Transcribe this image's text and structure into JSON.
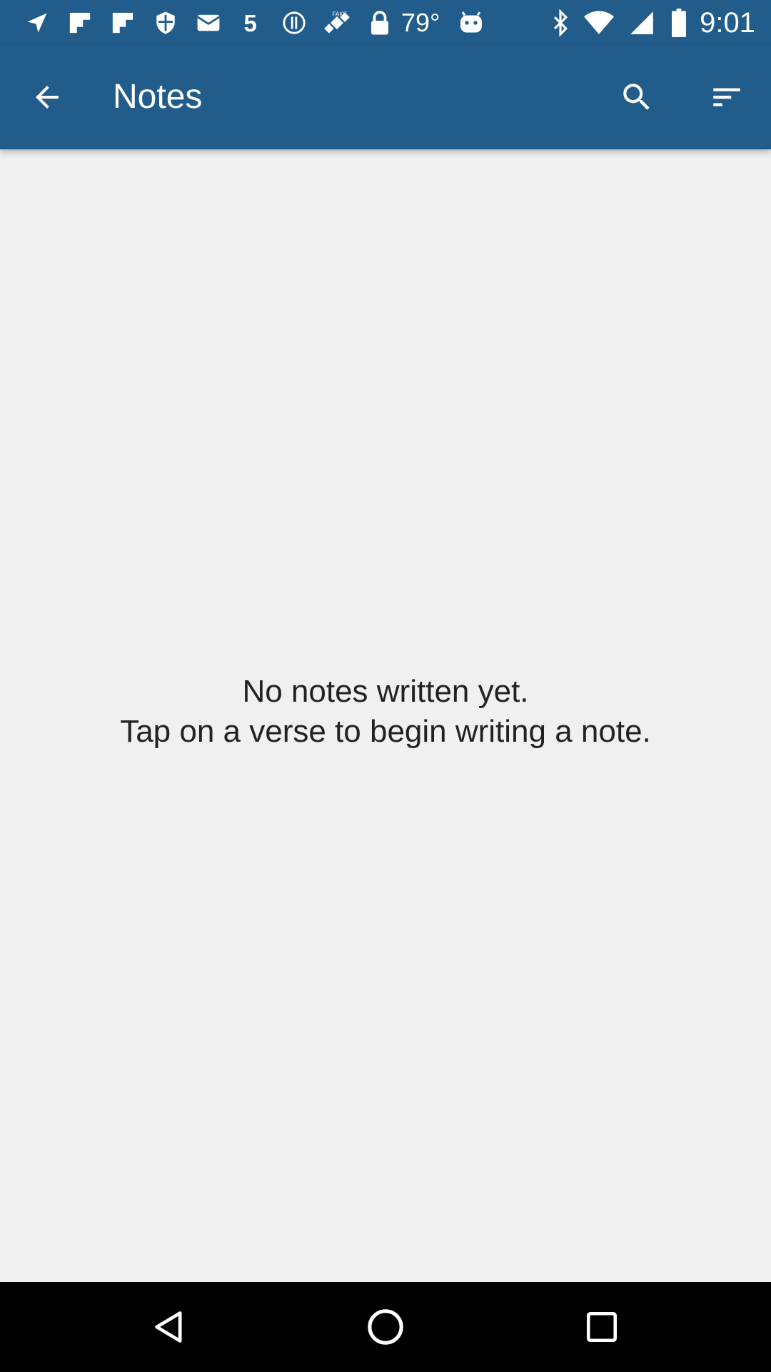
{
  "status_bar": {
    "icons": [
      "navigation-icon",
      "flipboard-icon",
      "flipboard-icon",
      "shield-icon",
      "mail-icon",
      "five-icon",
      "hd-icon",
      "satellite-fake-icon",
      "lock-icon"
    ],
    "temperature": "79°",
    "right_icons": [
      "android-icon",
      "bluetooth-icon",
      "wifi-icon",
      "signal-icon",
      "battery-icon"
    ],
    "time": "9:01"
  },
  "app_bar": {
    "title": "Notes",
    "back_icon": "arrow-back-icon",
    "search_icon": "search-icon",
    "sort_icon": "sort-icon",
    "color": "#215c8a"
  },
  "empty_state": {
    "line1": "No notes written yet.",
    "line2": "Tap on a verse to begin writing a note."
  },
  "nav_bar": {
    "back": "nav-back-icon",
    "home": "nav-home-icon",
    "recents": "nav-recents-icon"
  }
}
